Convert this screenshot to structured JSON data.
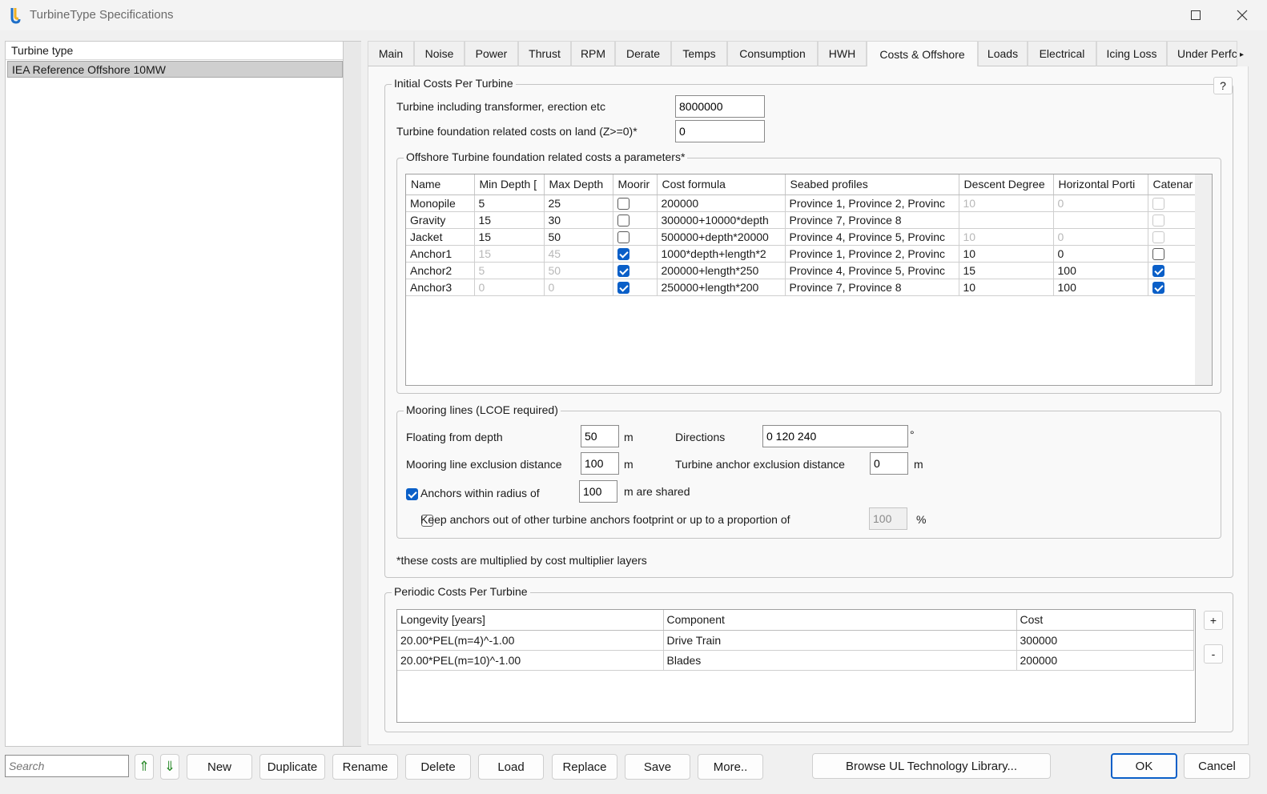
{
  "window": {
    "title": "TurbineType Specifications"
  },
  "left": {
    "header": "Turbine type",
    "items": [
      "IEA Reference Offshore 10MW"
    ]
  },
  "tabs": [
    "Main",
    "Noise",
    "Power",
    "Thrust",
    "RPM",
    "Derate",
    "Temps",
    "Consumption",
    "HWH",
    "Costs & Offshore",
    "Loads",
    "Electrical",
    "Icing Loss",
    "Under Perfc"
  ],
  "active_tab": "Costs & Offshore",
  "initial": {
    "title": "Initial Costs Per Turbine",
    "help": "?",
    "turbine_label": "Turbine including transformer, erection etc",
    "turbine_value": "8000000",
    "land_label": "Turbine foundation related costs on land (Z>=0)*",
    "land_value": "0"
  },
  "offshore": {
    "title": "Offshore Turbine foundation related costs a parameters*",
    "columns": [
      "Name",
      "Min Depth [",
      "Max Depth",
      "Moorir",
      "Cost formula",
      "Seabed profiles",
      "Descent Degree",
      "Horizontal Porti",
      "Catenar"
    ],
    "rows": [
      {
        "name": "Monopile",
        "min": "5",
        "max": "25",
        "mooring": false,
        "formula": "200000",
        "seabed": "Province 1, Province 2, Provinc",
        "descent": "10",
        "horizontal": "0",
        "catenary": false
      },
      {
        "name": "Gravity",
        "min": "15",
        "max": "30",
        "mooring": false,
        "formula": "300000+10000*depth",
        "seabed": "Province 7, Province 8",
        "descent": "",
        "horizontal": "",
        "catenary": false
      },
      {
        "name": "Jacket",
        "min": "15",
        "max": "50",
        "mooring": false,
        "formula": "500000+depth*20000",
        "seabed": "Province 4, Province 5, Provinc",
        "descent": "10",
        "horizontal": "0",
        "catenary": false
      },
      {
        "name": "Anchor1",
        "min": "15",
        "max": "45",
        "mooring": true,
        "formula": "1000*depth+length*2",
        "seabed": "Province 1, Province 2, Provinc",
        "descent": "10",
        "horizontal": "0",
        "catenary": false
      },
      {
        "name": "Anchor2",
        "min": "5",
        "max": "50",
        "mooring": true,
        "formula": "200000+length*250",
        "seabed": "Province 4, Province 5, Provinc",
        "descent": "15",
        "horizontal": "100",
        "catenary": true
      },
      {
        "name": "Anchor3",
        "min": "0",
        "max": "0",
        "mooring": true,
        "formula": "250000+length*200",
        "seabed": "Province 7, Province 8",
        "descent": "10",
        "horizontal": "100",
        "catenary": true
      }
    ]
  },
  "mooring": {
    "title": "Mooring lines (LCOE required)",
    "floating_label": "Floating from depth",
    "floating_value": "50",
    "floating_unit": "m",
    "directions_label": "Directions",
    "directions_value": "0 120 240",
    "directions_unit": "°",
    "exclusion_label": "Mooring line exclusion distance",
    "exclusion_value": "100",
    "exclusion_unit": "m",
    "anchor_excl_label": "Turbine anchor exclusion distance",
    "anchor_excl_value": "0",
    "anchor_excl_unit": "m",
    "shared_label": "Anchors within radius of",
    "shared_checked": true,
    "shared_value": "100",
    "shared_suffix": "m are shared",
    "keep_label": "Keep anchors out of other turbine anchors footprint or up to a proportion of",
    "keep_checked": false,
    "keep_value": "100",
    "keep_unit": "%"
  },
  "note": "*these costs are multiplied by cost multiplier layers",
  "periodic": {
    "title": "Periodic Costs Per Turbine",
    "columns": [
      "Longevity [years]",
      "Component",
      "Cost"
    ],
    "rows": [
      [
        "20.00*PEL(m=4)^-1.00",
        "Drive Train",
        "300000"
      ],
      [
        "20.00*PEL(m=10)^-1.00",
        "Blades",
        "200000"
      ]
    ],
    "add": "+",
    "remove": "-"
  },
  "bottom": {
    "search_placeholder": "Search",
    "up": "⇑",
    "down": "⇓",
    "new": "New",
    "duplicate": "Duplicate",
    "rename": "Rename",
    "delete": "Delete",
    "load": "Load",
    "replace": "Replace",
    "save": "Save",
    "more": "More..",
    "browse": "Browse UL Technology Library...",
    "ok": "OK",
    "cancel": "Cancel"
  }
}
